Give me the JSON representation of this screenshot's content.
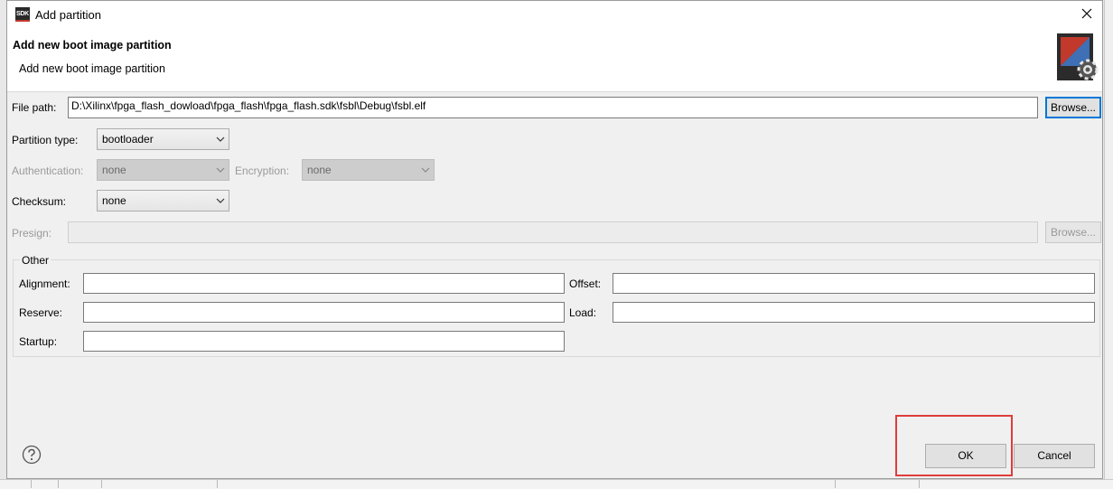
{
  "window": {
    "title": "Add partition",
    "app_icon_text": "SDK"
  },
  "header": {
    "title": "Add new boot image partition",
    "subtitle": "Add new boot image partition"
  },
  "form": {
    "file_path_label": "File path:",
    "file_path_value": "D:\\Xilinx\\fpga_flash_dowload\\fpga_flash\\fpga_flash.sdk\\fsbl\\Debug\\fsbl.elf",
    "browse_label": "Browse...",
    "partition_type_label": "Partition type:",
    "partition_type_value": "bootloader",
    "authentication_label": "Authentication:",
    "authentication_value": "none",
    "encryption_label": "Encryption:",
    "encryption_value": "none",
    "checksum_label": "Checksum:",
    "checksum_value": "none",
    "presign_label": "Presign:",
    "presign_value": "",
    "presign_browse_label": "Browse..."
  },
  "other": {
    "group_title": "Other",
    "alignment_label": "Alignment:",
    "alignment_value": "",
    "offset_label": "Offset:",
    "offset_value": "",
    "reserve_label": "Reserve:",
    "reserve_value": "",
    "load_label": "Load:",
    "load_value": "",
    "startup_label": "Startup:",
    "startup_value": ""
  },
  "buttons": {
    "ok_label": "OK",
    "cancel_label": "Cancel"
  },
  "colors": {
    "highlight_box": "#e03c3c",
    "focus_border": "#0078d7"
  },
  "icons": [
    "sdk-app-icon",
    "close-icon",
    "sdk-settings-icon",
    "help-icon",
    "chevron-down-icon"
  ]
}
